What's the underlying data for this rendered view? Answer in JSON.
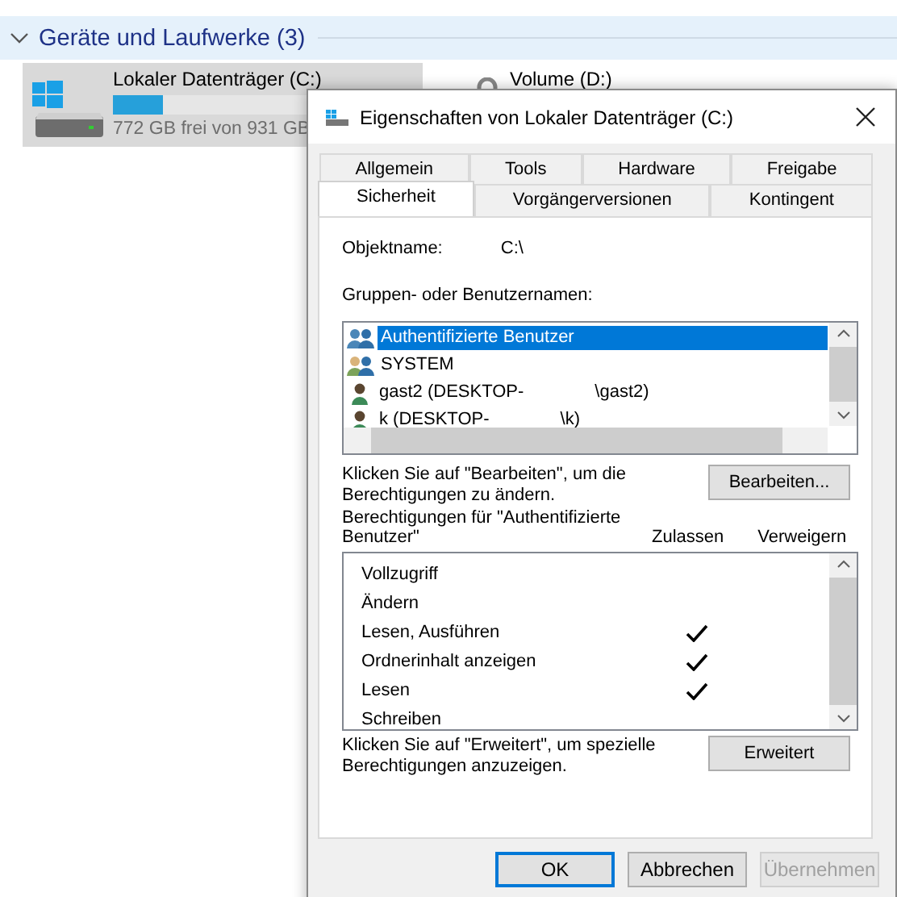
{
  "explorer": {
    "group": {
      "title": "Geräte und Laufwerke (3)",
      "expanded": true
    },
    "drives": [
      {
        "kind": "system",
        "name": "Lokaler Datenträger (C:)",
        "selected": true,
        "level": 0.17,
        "info": "772 GB frei von 931 GB"
      },
      {
        "kind": "locked",
        "name": "Volume (D:)",
        "selected": false
      }
    ]
  },
  "dialog": {
    "title": "Eigenschaften von Lokaler Datenträger (C:)",
    "tab_rows": [
      [
        {
          "label": "Allgemein",
          "selected": false
        },
        {
          "label": "Tools",
          "selected": false
        },
        {
          "label": "Hardware",
          "selected": false
        },
        {
          "label": "Freigabe",
          "selected": false
        }
      ],
      [
        {
          "label": "Sicherheit",
          "selected": true
        },
        {
          "label": "Vorgängerversionen",
          "selected": false
        },
        {
          "label": "Kontingent",
          "selected": false
        }
      ]
    ],
    "object_label": "Objektname:",
    "object_value": "C:\\",
    "users_label": "Gruppen- oder Benutzernamen:",
    "users": [
      {
        "kind": "group",
        "name": "Authentifizierte Benutzer",
        "selected": true
      },
      {
        "kind": "system",
        "name": "SYSTEM",
        "selected": false
      },
      {
        "kind": "user",
        "name": "gast2 (DESKTOP-",
        "suffix": "\\gast2)",
        "selected": false
      },
      {
        "kind": "user",
        "name": "k (DESKTOP-",
        "suffix": "\\k)",
        "selected": false
      }
    ],
    "edit_hint": "Klicken Sie auf \"Bearbeiten\", um die Berechtigungen zu ändern.",
    "edit_button": "Bearbeiten...",
    "perm_label": "Berechtigungen für \"Authentifizierte Benutzer\"",
    "allow_header": "Zulassen",
    "deny_header": "Verweigern",
    "permissions": [
      {
        "name": "Vollzugriff",
        "allow": false
      },
      {
        "name": "Ändern",
        "allow": false
      },
      {
        "name": "Lesen, Ausführen",
        "allow": true
      },
      {
        "name": "Ordnerinhalt anzeigen",
        "allow": true
      },
      {
        "name": "Lesen",
        "allow": true
      },
      {
        "name": "Schreiben",
        "allow": false
      }
    ],
    "advanced_hint": "Klicken Sie auf \"Erweitert\", um spezielle Berechtigungen anzuzeigen.",
    "advanced_button": "Erweitert",
    "buttons": [
      {
        "label": "OK",
        "kind": "default",
        "disabled": false
      },
      {
        "label": "Abbrechen",
        "kind": "normal",
        "disabled": false
      },
      {
        "label": "Übernehmen",
        "kind": "normal",
        "disabled": true
      }
    ]
  }
}
